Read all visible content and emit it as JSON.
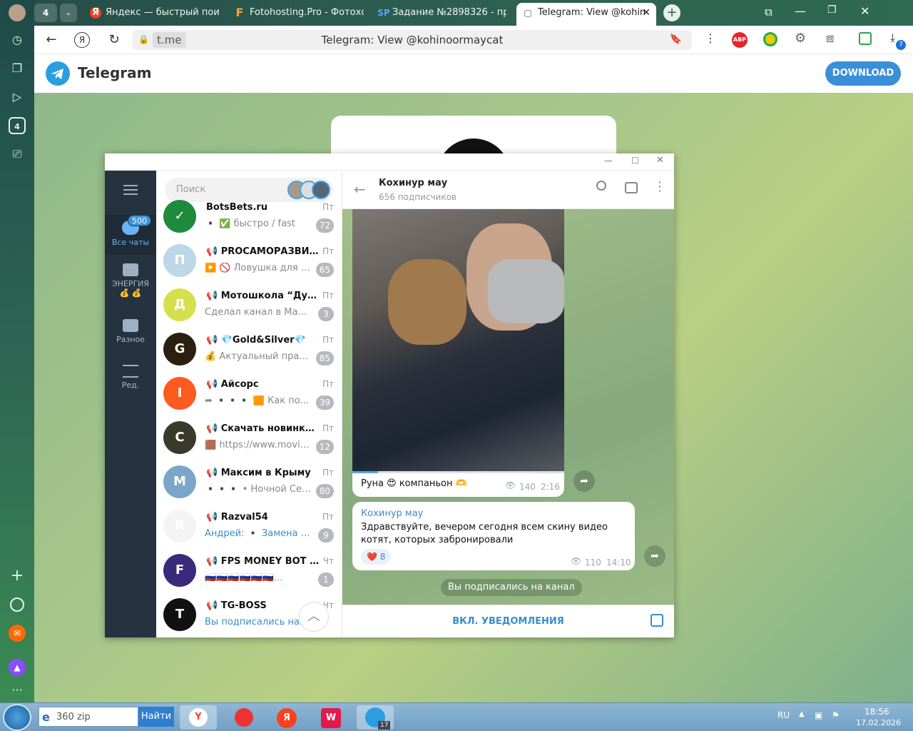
{
  "browser": {
    "tab_count": "4",
    "tabs": [
      {
        "label": "Яндекс — быстрый поиск",
        "fav": "Я",
        "fav_color": "#fc3f1d"
      },
      {
        "label": "Fotohosting.Pro - Фотохо",
        "fav": "F",
        "fav_color": "#f5a623"
      },
      {
        "label": "Задание №2898326 - про",
        "fav": "SP",
        "fav_color": "#3c8ce7"
      },
      {
        "label": "Telegram: View @kohin",
        "fav": "▢",
        "fav_color": "#555555"
      }
    ],
    "domain": "t.me",
    "page_title": "Telegram: View @kohinoormaycat",
    "abp_label": "ABP",
    "downloads_badge": "7"
  },
  "tg_web": {
    "brand": "Telegram",
    "download_label": "DOWNLOAD"
  },
  "app": {
    "folders": [
      {
        "label": "Все чаты",
        "badge": "500"
      },
      {
        "label": "ЭНЕРГИЯ",
        "sub": "💰 💰"
      },
      {
        "label": "Разное"
      },
      {
        "label": "Ред."
      }
    ],
    "search_placeholder": "Поиск",
    "chats": [
      {
        "name": "BotsBets.ru",
        "date": "Пт",
        "preview": "▪️ ✅ быстро / fast",
        "badge": "72",
        "color": "#1e8a3c",
        "initials": "✓"
      },
      {
        "name": "📢 PROСАМОРАЗВИТИЕ",
        "date": "Пт",
        "preview": "▶️ 🚫 Ловушка для м...",
        "badge": "65",
        "color": "#bcd7e6",
        "initials": "П"
      },
      {
        "name": "📢 Мотошкола “Дух Эн...",
        "date": "Пт",
        "preview": "Сделал канал в Максе. П...",
        "badge": "3",
        "color": "#d6e04c",
        "initials": "Д"
      },
      {
        "name": "📢 💎Gold&Silver💎",
        "date": "Пт",
        "preview": "💰 Актуальный прайс ...",
        "badge": "85",
        "color": "#2b2010",
        "initials": "G"
      },
      {
        "name": "📢 Айсорс",
        "date": "Пт",
        "preview": "➦ ▪️▪️▪️ 🟧 Как по...",
        "badge": "39",
        "color": "#ff5a1f",
        "initials": "I"
      },
      {
        "name": "📢 Скачать новинки к...",
        "date": "Пт",
        "preview": "🟫 https://www.moviel...",
        "badge": "12",
        "color": "#3a3a2a",
        "initials": "С"
      },
      {
        "name": "📢 Максим в Крыму",
        "date": "Пт",
        "preview": "▪️▪️▪️ • Ночной Сев...",
        "badge": "80",
        "color": "#7aa7c9",
        "initials": "М"
      },
      {
        "name": "📢 Razval54",
        "date": "Пт",
        "preview": "Андрей: ▪️ Замена рул...",
        "badge": "9",
        "color": "#f4f4f4",
        "initials": "R"
      },
      {
        "name": "📢 FPS MONEY BOT 📯",
        "date": "Чт",
        "preview": "🇷🇺🇷🇺🇷🇺🇷🇺🇷🇺🇷🇺...",
        "badge": "1",
        "color": "#3a2b7a",
        "initials": "F"
      },
      {
        "name": "📢 TG-BOSS",
        "date": "Чт",
        "preview": "Вы подписались на ка",
        "badge": "",
        "color": "#111111",
        "initials": "T"
      }
    ],
    "channel": {
      "name": "Кохинур мау",
      "subs": "656 подписчиков"
    },
    "video_msg": {
      "caption": "Руна 😍 компаньон 🫶",
      "views": "140",
      "time": "2:16"
    },
    "text_msg": {
      "author": "Кохинур мау",
      "text": "Здравствуйте, вечером  сегодня всем  скину видео котят, которых забронировали",
      "reaction": "❤️ 8",
      "views": "110",
      "time": "14:10"
    },
    "service": "Вы подписались на канал",
    "notify_label": "ВКЛ. УВЕДОМЛЕНИЯ"
  },
  "taskbar": {
    "search_value": "360 zip",
    "search_btn": "Найти",
    "lang": "RU",
    "time": "18:56",
    "date": "17.02.2026",
    "tg_badge": "17"
  }
}
